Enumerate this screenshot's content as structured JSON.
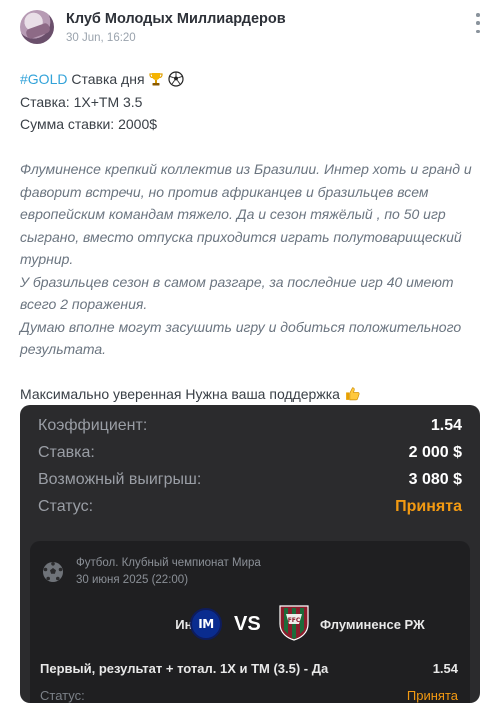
{
  "channel": {
    "name": "Клуб Молодых Миллиардеров",
    "date": "30 Jun, 16:20"
  },
  "post": {
    "hashtag": "#GOLD",
    "title": "Ставка дня",
    "title_emojis": [
      "trophy-emoji",
      "soccer-ball-emoji"
    ],
    "bet_line": "Ставка: 1Х+ТМ 3.5",
    "amount_line": "Сумма ставки: 2000$",
    "analysis_lines": [
      "Флуминенсе крепкий коллектив из Бразилии. Интер хоть и гранд и",
      "фаворит встречи, но против африканцев и бразильцев всем",
      "европейским командам тяжело. Да и сезон тяжёлый , по 50 игр",
      "сыграно, вместо отпуска приходится играть полутоварищеский",
      "турнир.",
      "У бразильцев сезон в самом разгаре, за последние игр 40 имеют",
      "всего 2 поражения.",
      "Думаю вполне могут засушить игру и добиться положительного",
      "результата."
    ],
    "closing": "Максимально уверенная Нужна ваша поддержка",
    "closing_emoji": "thumbs-up-emoji"
  },
  "ticket": {
    "coef_label": "Коэффициент:",
    "coef_value": "1.54",
    "stake_label": "Ставка:",
    "stake_value": "2 000 $",
    "win_label": "Возможный выигрыш:",
    "win_value": "3 080 $",
    "status_label": "Статус:",
    "status_value": "Принята",
    "event": {
      "league": "Футбол. Клубный чемпионат Мира",
      "date": "30 июня 2025 (22:00)",
      "team1": "Интер",
      "vs": "VS",
      "team2": "Флуминенсе РЖ",
      "bet": "Первый, результат + тотал. 1Х и ТМ (3.5) - Да",
      "odds": "1.54",
      "status_label": "Статус:",
      "status_value": "Принята"
    }
  },
  "colors": {
    "hashtag": "#33a3d9",
    "status": "#f39a12",
    "card": "#2b2b2d"
  }
}
